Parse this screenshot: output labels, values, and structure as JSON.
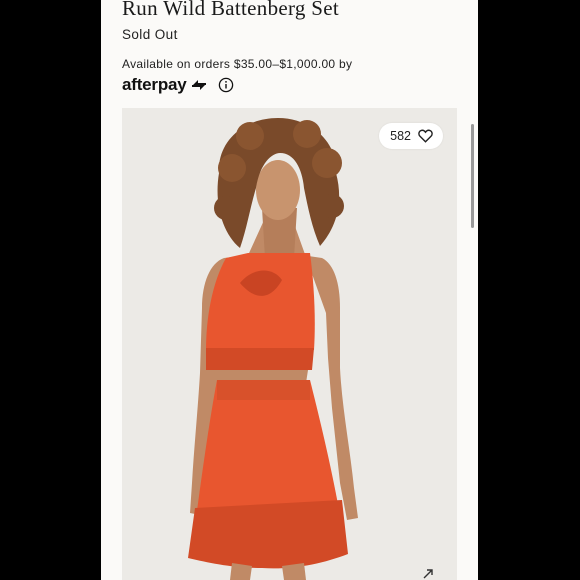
{
  "product": {
    "title": "Run Wild Battenberg Set",
    "status": "Sold Out"
  },
  "payment": {
    "availability_text": "Available on orders $35.00–$1,000.00 by",
    "provider": "afterpay",
    "provider_icon": "afterpay-arrows-icon",
    "info_icon": "info-icon"
  },
  "photo": {
    "like_count": "582",
    "like_icon": "heart-icon",
    "description": "Model wearing orange lace halter crop top and matching skirt"
  },
  "colors": {
    "dress": "#e8562f",
    "background": "#fbfaf8"
  }
}
